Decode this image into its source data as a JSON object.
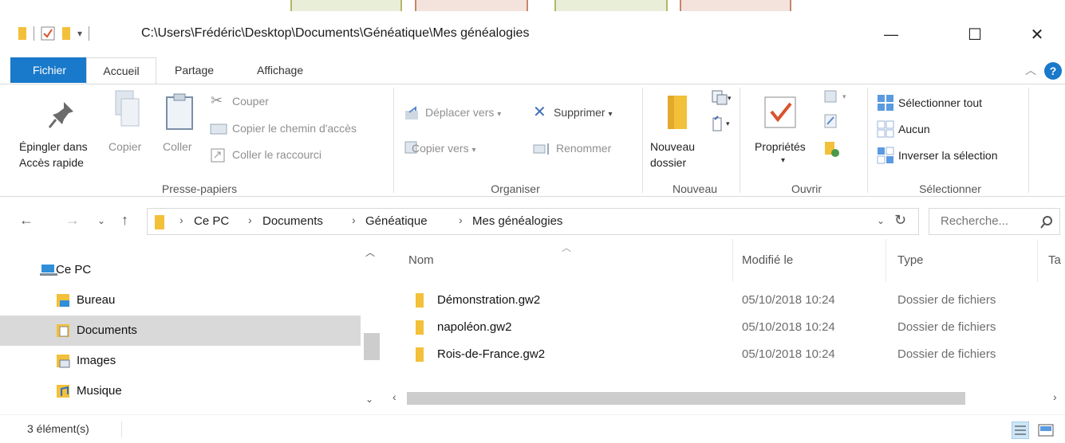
{
  "window": {
    "path": "C:\\Users\\Frédéric\\Desktop\\Documents\\Généatique\\Mes généalogies",
    "minimize": "—",
    "maximize": "☐",
    "close": "✕"
  },
  "ribbon_tabs": [
    {
      "label": "Fichier"
    },
    {
      "label": "Accueil"
    },
    {
      "label": "Partage"
    },
    {
      "label": "Affichage"
    }
  ],
  "presse_papiers": {
    "label": "Presse-papiers",
    "pin_line1": "Épingler dans",
    "pin_line2": "Accès rapide",
    "copy": "Copier",
    "paste": "Coller",
    "cut": "Couper",
    "copy_path": "Copier le chemin d'accès",
    "paste_shortcut": "Coller le raccourci"
  },
  "organiser": {
    "label": "Organiser",
    "move_to": "Déplacer vers",
    "copy_to": "Copier vers",
    "delete": "Supprimer",
    "rename": "Renommer"
  },
  "nouveau": {
    "label": "Nouveau",
    "new_folder_line1": "Nouveau",
    "new_folder_line2": "dossier"
  },
  "ouvrir": {
    "label": "Ouvrir",
    "properties": "Propriétés"
  },
  "selectionner": {
    "label": "Sélectionner",
    "select_all": "Sélectionner tout",
    "none": "Aucun",
    "invert": "Inverser la sélection"
  },
  "address": {
    "crumbs": [
      "Ce PC",
      "Documents",
      "Généatique",
      "Mes généalogies"
    ],
    "search_placeholder": "Recherche..."
  },
  "nav": {
    "items": [
      {
        "label": "Ce PC",
        "icon": "computer-icon"
      },
      {
        "label": "Bureau",
        "icon": "desktop-folder-icon"
      },
      {
        "label": "Documents",
        "icon": "documents-folder-icon"
      },
      {
        "label": "Images",
        "icon": "pictures-folder-icon"
      },
      {
        "label": "Musique",
        "icon": "music-folder-icon"
      }
    ]
  },
  "files": {
    "columns": [
      "Nom",
      "Modifié le",
      "Type",
      "Ta"
    ],
    "rows": [
      {
        "name": "Démonstration.gw2",
        "date": "05/10/2018 10:24",
        "type": "Dossier de fichiers"
      },
      {
        "name": "napoléon.gw2",
        "date": "05/10/2018 10:24",
        "type": "Dossier de fichiers"
      },
      {
        "name": "Rois-de-France.gw2",
        "date": "05/10/2018 10:24",
        "type": "Dossier de fichiers"
      }
    ]
  },
  "status": {
    "count": "3 élément(s)"
  },
  "colors": {
    "accent": "#1979ca",
    "folder": "#f3c03a",
    "selected": "#d9d9d9"
  }
}
